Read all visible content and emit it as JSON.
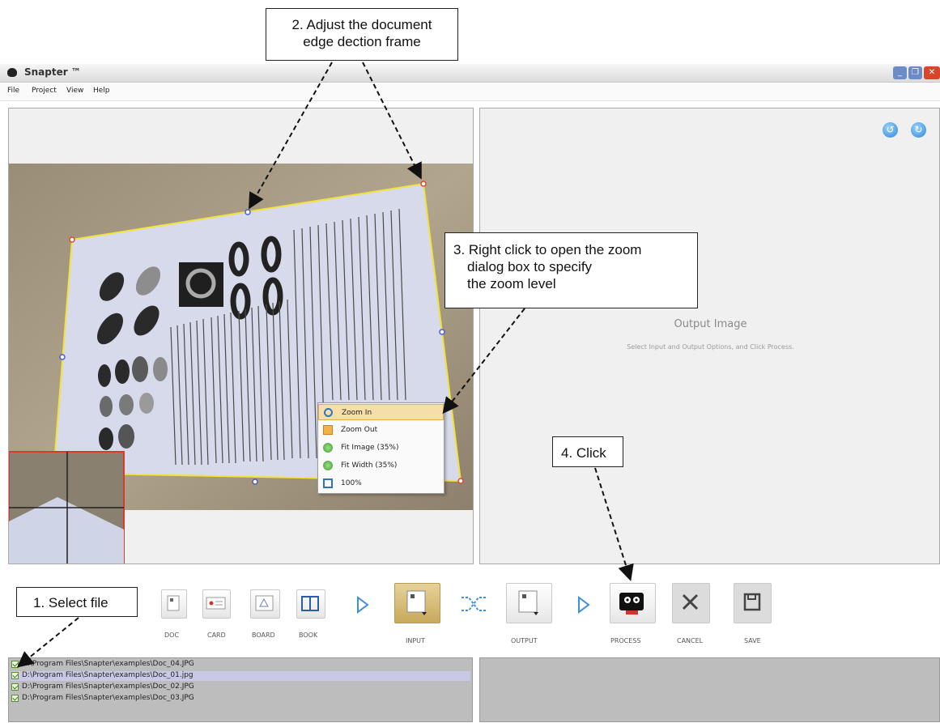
{
  "callouts": {
    "step2": [
      "2. Adjust the document",
      "edge dection frame"
    ],
    "step3": [
      "3. Right click to open the zoom",
      "dialog box to specify",
      "the zoom level"
    ],
    "step4": "4. Click",
    "step1": "1. Select file"
  },
  "window": {
    "title": "Snapter ™",
    "menu": [
      "File",
      "Project",
      "View",
      "Help"
    ]
  },
  "output_panel": {
    "title": "Output Image",
    "hint": "Select Input and Output Options, and Click Process."
  },
  "context_menu": {
    "items": [
      {
        "label": "Zoom In",
        "icon": "zoom-in-icon",
        "highlighted": true
      },
      {
        "label": "Zoom Out",
        "icon": "zoom-out-icon"
      },
      {
        "label": "Fit Image (35%)",
        "icon": "fit-image-icon"
      },
      {
        "label": "Fit Width (35%)",
        "icon": "fit-width-icon"
      },
      {
        "label": "100%",
        "icon": "actual-size-icon"
      }
    ]
  },
  "toolbar": {
    "doc": "DOC",
    "card": "CARD",
    "board": "BOARD",
    "book": "BOOK",
    "input": "INPUT",
    "output": "OUTPUT",
    "process": "PROCESS",
    "cancel": "CANCEL",
    "save": "SAVE"
  },
  "files": [
    {
      "path": "D:\\Program Files\\Snapter\\examples\\Doc_04.JPG",
      "checked": true,
      "selected": false
    },
    {
      "path": "D:\\Program Files\\Snapter\\examples\\Doc_01.jpg",
      "checked": true,
      "selected": true
    },
    {
      "path": "D:\\Program Files\\Snapter\\examples\\Doc_02.JPG",
      "checked": true,
      "selected": false
    },
    {
      "path": "D:\\Program Files\\Snapter\\examples\\Doc_03.JPG",
      "checked": true,
      "selected": false
    }
  ],
  "colors": {
    "frame": "#f0e040",
    "accent": "#3c8fd8",
    "selected_row": "#c9c9e6"
  }
}
